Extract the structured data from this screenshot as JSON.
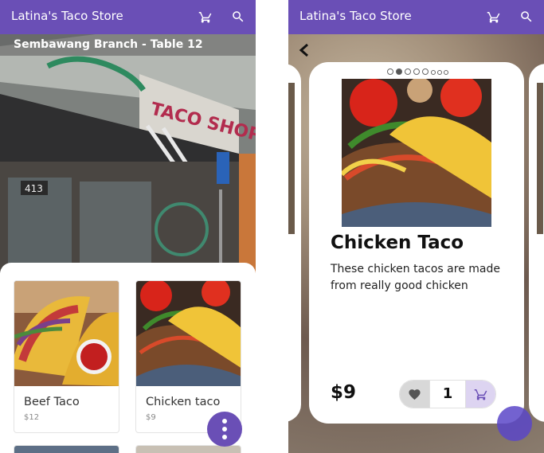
{
  "app": {
    "title": "Latina's Taco Store"
  },
  "left_screen": {
    "branch_label": "Sembawang Branch - Table 12",
    "storefront_sign": "TACO SHOP",
    "storefront_number": "413",
    "menu_items": [
      {
        "name": "Beef Taco",
        "price": "$12"
      },
      {
        "name": "Chicken taco",
        "price": "$9"
      }
    ]
  },
  "right_screen": {
    "carousel_total": 8,
    "carousel_active": 2,
    "product": {
      "name": "Chicken Taco",
      "description": "These chicken tacos are made from really good chicken",
      "price": "$9",
      "quantity": "1"
    }
  },
  "icons": {
    "cart": "cart-icon",
    "search": "search-icon",
    "back": "chevron-left-icon",
    "favorite": "heart-icon",
    "more": "more-vertical-icon"
  },
  "colors": {
    "primary": "#6a4fb6",
    "stepper_cart_bg": "#ddd4f1",
    "stepper_fav_bg": "#d8d8d8"
  }
}
